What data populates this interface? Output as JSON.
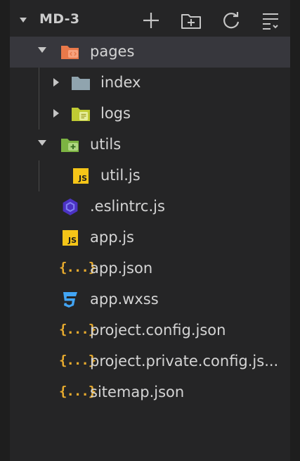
{
  "explorer": {
    "project_name": "MD-3",
    "toolbar": [
      {
        "name": "new-file-icon"
      },
      {
        "name": "new-folder-icon"
      },
      {
        "name": "refresh-icon"
      },
      {
        "name": "collapse-all-icon"
      }
    ]
  },
  "tree": {
    "pages": "pages",
    "index": "index",
    "logs": "logs",
    "utils": "utils",
    "util_js": "util.js",
    "eslintrc": ".eslintrc.js",
    "app_js": "app.js",
    "app_json": "app.json",
    "app_wxss": "app.wxss",
    "project_config": "project.config.json",
    "project_private_config": "project.private.config.js...",
    "sitemap": "sitemap.json"
  },
  "icons": {
    "js_badge": "JS",
    "json_badge": "{...}"
  },
  "colors": {
    "background": "#252526",
    "selected_row": "#37373d",
    "text": "#d4d4d4",
    "js_yellow": "#f5c518",
    "json_orange": "#e8ab2e",
    "css_blue": "#42a5f5",
    "eslint_purple": "#4b32c3",
    "pages_folder_orange": "#e9794a",
    "utils_folder_green": "#7cb342",
    "logs_folder_yellowgreen": "#c0ca33",
    "index_folder_grey": "#90a4ae"
  }
}
